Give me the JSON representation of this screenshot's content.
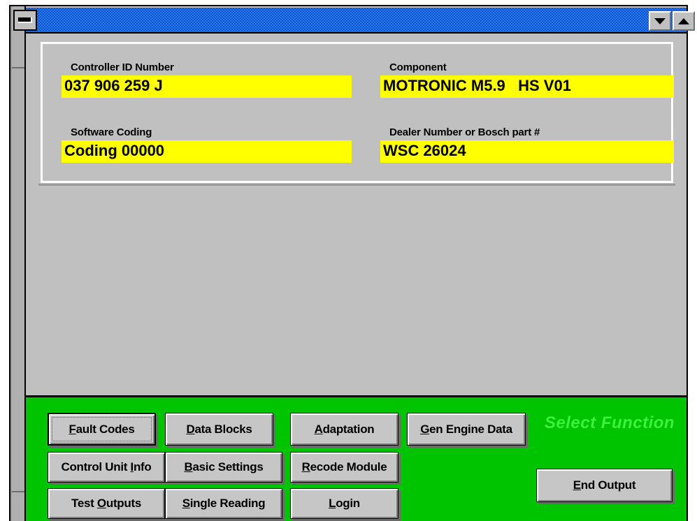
{
  "window": {
    "title": "",
    "minimize_label": "minimize",
    "restore_label": "restore",
    "maximize_label": "maximize"
  },
  "identification": {
    "fields": [
      {
        "label": "Controller ID Number",
        "value": "037 906 259 J"
      },
      {
        "label": "Component",
        "value": "MOTRONIC M5.9   HS V01"
      },
      {
        "label": "Software Coding",
        "value": "Coding 00000"
      },
      {
        "label": "Dealer Number or Bosch part #",
        "value": "WSC 26024"
      }
    ]
  },
  "functions": {
    "hint": "Select Function",
    "buttons": [
      {
        "pre": "",
        "acc": "F",
        "post": "ault Codes",
        "focused": true
      },
      {
        "pre": "",
        "acc": "D",
        "post": "ata Blocks",
        "focused": false
      },
      {
        "pre": "",
        "acc": "A",
        "post": "daptation",
        "focused": false
      },
      {
        "pre": "",
        "acc": "G",
        "post": "en Engine Data",
        "focused": false
      },
      {
        "pre": "Control Unit ",
        "acc": "I",
        "post": "nfo",
        "focused": false
      },
      {
        "pre": "",
        "acc": "B",
        "post": "asic Settings",
        "focused": false
      },
      {
        "pre": "",
        "acc": "R",
        "post": "ecode Module",
        "focused": false
      },
      {
        "pre": "Test ",
        "acc": "O",
        "post": "utputs",
        "focused": false
      },
      {
        "pre": "",
        "acc": "S",
        "post": "ingle Reading",
        "focused": false
      },
      {
        "pre": "",
        "acc": "L",
        "post": "ogin",
        "focused": false
      }
    ],
    "end_button": {
      "pre": "",
      "acc": "E",
      "post": "nd Output"
    }
  },
  "colors": {
    "titlebar_blue": "#0a55cf",
    "panel_green": "#00c400",
    "hint_green": "#3ef03e",
    "field_yellow": "#ffff00",
    "face_gray": "#c0c0c0"
  }
}
